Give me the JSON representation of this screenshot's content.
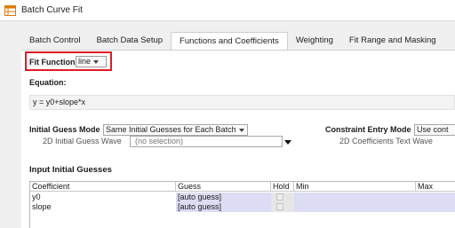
{
  "window": {
    "title": "Batch Curve Fit"
  },
  "tabs": [
    {
      "label": "Batch Control"
    },
    {
      "label": "Batch Data Setup"
    },
    {
      "label": "Functions and Coefficients"
    },
    {
      "label": "Weighting"
    },
    {
      "label": "Fit Range and Masking"
    }
  ],
  "active_tab": "Functions and Coefficients",
  "fit_function": {
    "label": "Fit Function",
    "value": "line"
  },
  "equation": {
    "label": "Equation:",
    "value": "y = y0+slope*x"
  },
  "initial_guess_mode": {
    "label": "Initial Guess Mode",
    "value": "Same Initial Guesses for Each Batch"
  },
  "wave_2d": {
    "label": "2D Initial Guess Wave",
    "value": "(no selection)"
  },
  "constraint_entry_mode": {
    "label": "Constraint Entry Mode",
    "value": "Use cont"
  },
  "coef_text_wave": {
    "label": "2D Coefficients Text Wave"
  },
  "input_initial_guesses": {
    "heading": "Input Initial Guesses",
    "columns": [
      "Coefficient",
      "Guess",
      "Hold",
      "Min",
      "Max"
    ],
    "rows": [
      {
        "coefficient": "y0",
        "guess": "[auto guess]"
      },
      {
        "coefficient": "slope",
        "guess": "[auto guess]"
      }
    ]
  },
  "colors": {
    "highlight_border": "#e01b24",
    "table_cell_bg": "#dcdcf4"
  }
}
